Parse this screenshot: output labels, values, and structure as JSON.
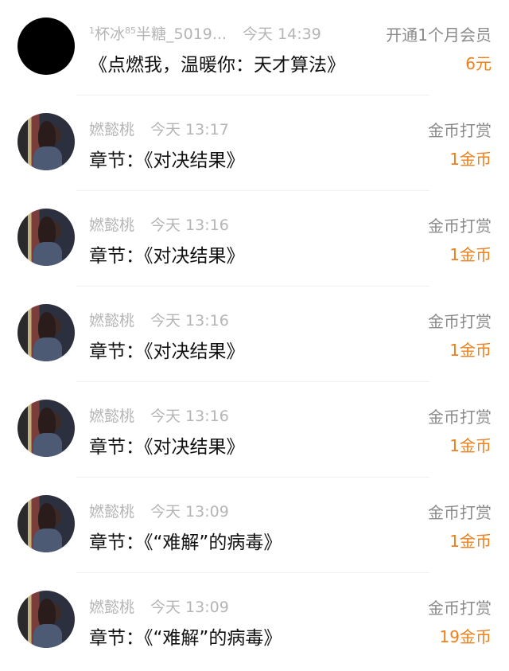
{
  "records": [
    {
      "name_prefix": "1",
      "name_main": "杯冰",
      "name_sup": "85",
      "name_rest": "半糖_5019...",
      "time": "今天 14:39",
      "title": "《点燃我，温暖你：天才算法》",
      "type": "开通1个月会员",
      "amount": "6元"
    },
    {
      "name": "㜣懿桃",
      "time": "今天 13:17",
      "title": "章节：《对决结果》",
      "type": "金币打赏",
      "amount": "1金币"
    },
    {
      "name": "㜣懿桃",
      "time": "今天 13:16",
      "title": "章节：《对决结果》",
      "type": "金币打赏",
      "amount": "1金币"
    },
    {
      "name": "㜣懿桃",
      "time": "今天 13:16",
      "title": "章节：《对决结果》",
      "type": "金币打赏",
      "amount": "1金币"
    },
    {
      "name": "㜣懿桃",
      "time": "今天 13:16",
      "title": "章节：《对决结果》",
      "type": "金币打赏",
      "amount": "1金币"
    },
    {
      "name": "㜣懿桃",
      "time": "今天 13:09",
      "title": "章节：《“难解”的病毒》",
      "type": "金币打赏",
      "amount": "1金币"
    },
    {
      "name": "㜣懿桃",
      "time": "今天 13:09",
      "title": "章节：《“难解”的病毒》",
      "type": "金币打赏",
      "amount": "19金币"
    }
  ]
}
